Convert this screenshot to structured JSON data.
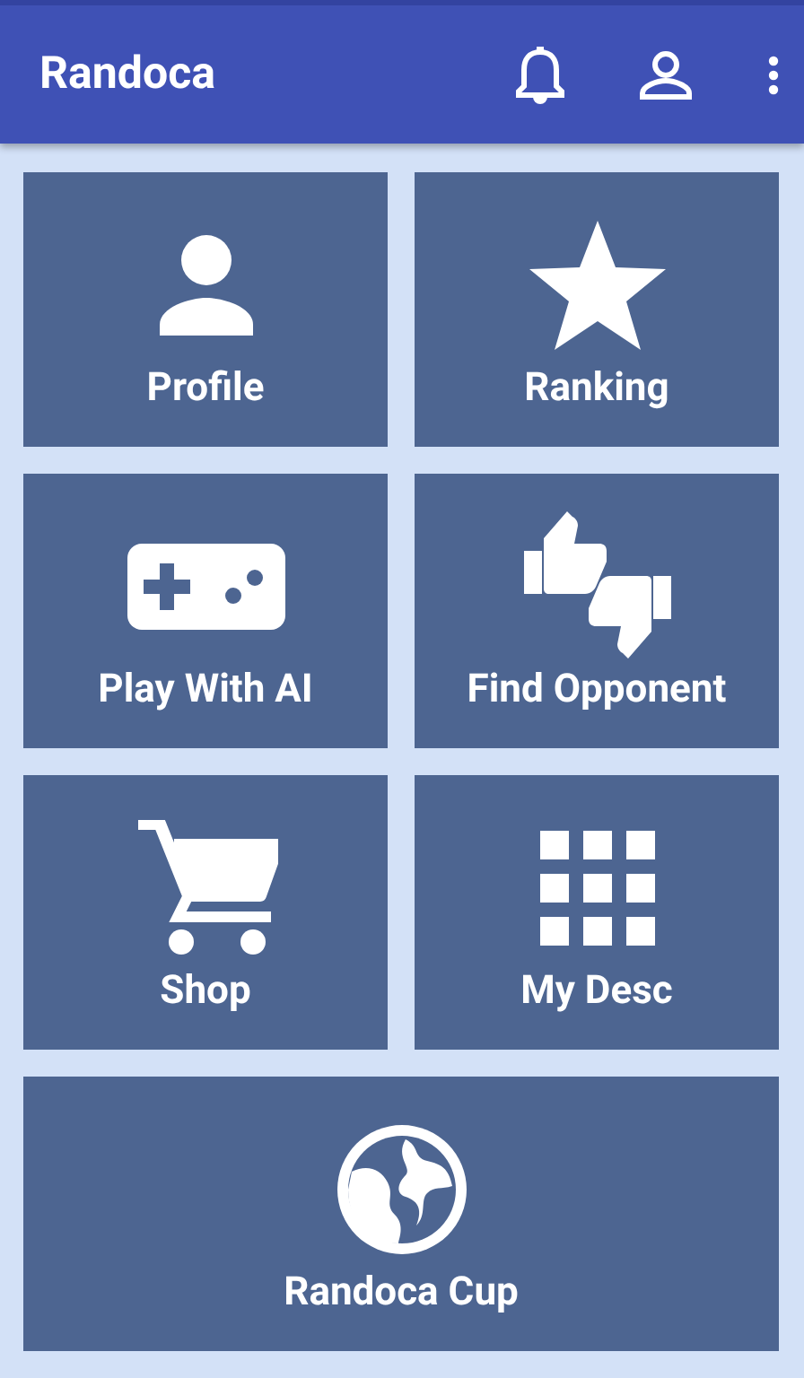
{
  "app_bar": {
    "title": "Randoca"
  },
  "tiles": [
    {
      "label": "Profile"
    },
    {
      "label": "Ranking"
    },
    {
      "label": "Play With AI"
    },
    {
      "label": "Find Opponent"
    },
    {
      "label": "Shop"
    },
    {
      "label": "My Desc"
    },
    {
      "label": "Randoca Cup"
    }
  ]
}
